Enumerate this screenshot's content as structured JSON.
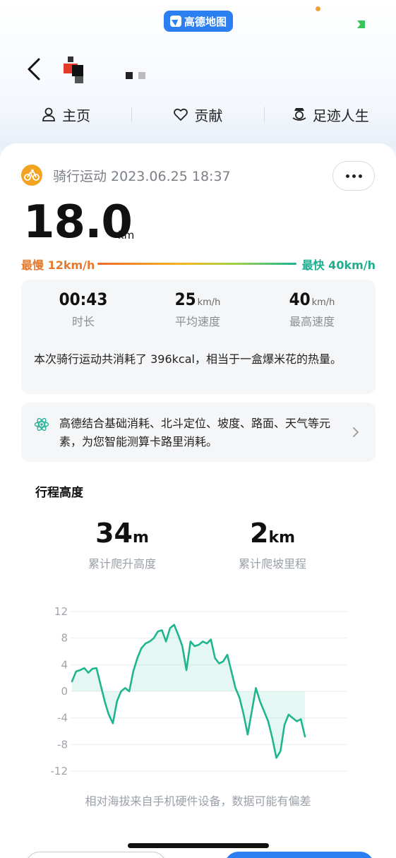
{
  "status": {
    "app_badge": "高德地图"
  },
  "header": {
    "back_icon": "chevron-left-icon"
  },
  "nav": {
    "items": [
      {
        "label": "主页",
        "icon": "person-icon"
      },
      {
        "label": "贡献",
        "icon": "heart-icon"
      },
      {
        "label": "足迹人生",
        "icon": "footprint-icon"
      }
    ]
  },
  "activity": {
    "title": "骑行运动 2023.06.25 18:37",
    "distance": "18.0",
    "distance_unit": "km",
    "slowest": "最慢 12km/h",
    "fastest": "最快 40km/h"
  },
  "stats": {
    "duration": {
      "value": "00:43",
      "unit": "",
      "label": "时长"
    },
    "avg_speed": {
      "value": "25",
      "unit": "km/h",
      "label": "平均速度"
    },
    "max_speed": {
      "value": "40",
      "unit": "km/h",
      "label": "最高速度"
    },
    "description": "本次骑行运动共消耗了 396kcal，相当于一盒爆米花的热量。"
  },
  "info": {
    "text": "高德结合基础消耗、北斗定位、坡度、路面、天气等元素，为您智能测算卡路里消耗。"
  },
  "elevation": {
    "section_title": "行程高度",
    "climb_height": {
      "value": "34",
      "unit": "m",
      "label": "累计爬升高度"
    },
    "climb_distance": {
      "value": "2",
      "unit": "km",
      "label": "累计爬坡里程"
    },
    "note": "相对海拔来自手机硬件设备，数据可能有偏差"
  },
  "colors": {
    "accent": "#1fae8f",
    "slow": "#e57a2e",
    "brand": "#2b7ff0",
    "bike": "#f2a420"
  },
  "chart_data": {
    "type": "area",
    "title": "",
    "xlabel": "",
    "ylabel": "",
    "ylim": [
      -12,
      12
    ],
    "yticks": [
      "12",
      "8",
      "4",
      "0",
      "-4",
      "-8",
      "-12"
    ],
    "grid": true,
    "series": [
      {
        "values": [
          1.5,
          3,
          3.2,
          3.5,
          2.8,
          3.4,
          3.5,
          1,
          -1.5,
          -3.5,
          -4.8,
          -1.5,
          0,
          0.5,
          0,
          3,
          5,
          6.5,
          7.2,
          7.5,
          8,
          9,
          9.2,
          7.5,
          9.5,
          10,
          8.5,
          6.8,
          3.2,
          7.5,
          6.8,
          7,
          7.5,
          7.2,
          7.8,
          5,
          4.2,
          4.5,
          5.5,
          3,
          0.5,
          -1,
          -3.5,
          -6.5,
          -3,
          0.5,
          -1.5,
          -3,
          -4.5,
          -7,
          -10,
          -9,
          -5,
          -3.5,
          -4,
          -4.5,
          -4.2,
          -6.8
        ]
      }
    ]
  }
}
